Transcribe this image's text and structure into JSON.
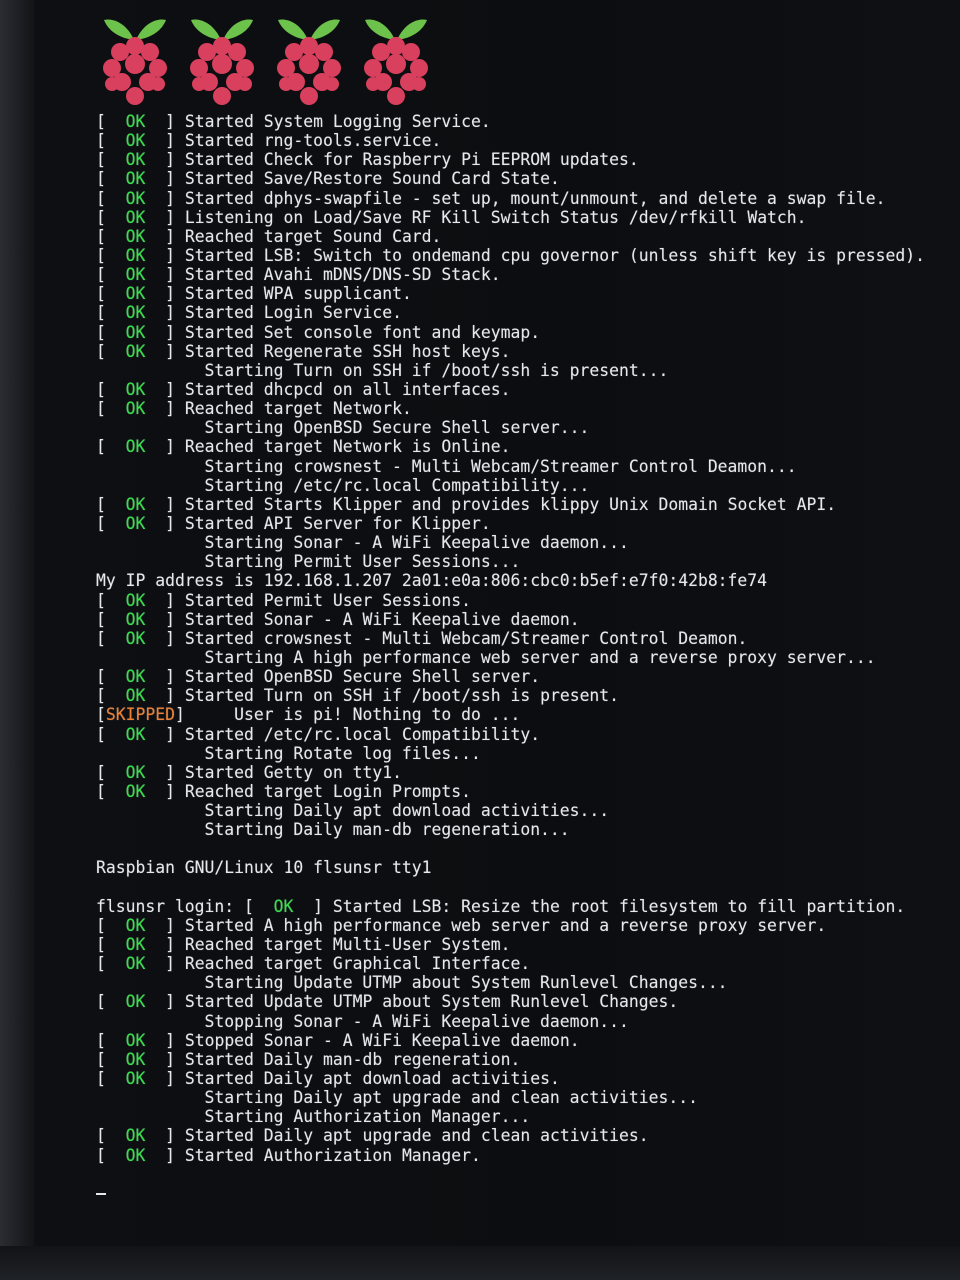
{
  "screen": {
    "logos": [
      "raspberry-logo",
      "raspberry-logo",
      "raspberry-logo",
      "raspberry-logo"
    ],
    "colors": {
      "ok": "#35e04a",
      "skipped": "#f08030",
      "text": "#e6e8ea",
      "background": "#0c0e12",
      "berry": "#d8405e",
      "leaf": "#6cc24a"
    }
  },
  "console": {
    "lines": [
      {
        "status": "OK",
        "text": "Started System Logging Service."
      },
      {
        "status": "OK",
        "text": "Started rng-tools.service."
      },
      {
        "status": "OK",
        "text": "Started Check for Raspberry Pi EEPROM updates."
      },
      {
        "status": "OK",
        "text": "Started Save/Restore Sound Card State."
      },
      {
        "status": "OK",
        "text": "Started dphys-swapfile - set up, mount/unmount, and delete a swap file."
      },
      {
        "status": "OK",
        "text": "Listening on Load/Save RF Kill Switch Status /dev/rfkill Watch."
      },
      {
        "status": "OK",
        "text": "Reached target Sound Card."
      },
      {
        "status": "OK",
        "text": "Started LSB: Switch to ondemand cpu governor (unless shift key is pressed)."
      },
      {
        "status": "OK",
        "text": "Started Avahi mDNS/DNS-SD Stack."
      },
      {
        "status": "OK",
        "text": "Started WPA supplicant."
      },
      {
        "status": "OK",
        "text": "Started Login Service."
      },
      {
        "status": "OK",
        "text": "Started Set console font and keymap."
      },
      {
        "status": "OK",
        "text": "Started Regenerate SSH host keys."
      },
      {
        "status": "",
        "text": "Starting Turn on SSH if /boot/ssh is present..."
      },
      {
        "status": "OK",
        "text": "Started dhcpcd on all interfaces."
      },
      {
        "status": "OK",
        "text": "Reached target Network."
      },
      {
        "status": "",
        "text": "Starting OpenBSD Secure Shell server..."
      },
      {
        "status": "OK",
        "text": "Reached target Network is Online."
      },
      {
        "status": "",
        "text": "Starting crowsnest - Multi Webcam/Streamer Control Deamon..."
      },
      {
        "status": "",
        "text": "Starting /etc/rc.local Compatibility..."
      },
      {
        "status": "OK",
        "text": "Started Starts Klipper and provides klippy Unix Domain Socket API."
      },
      {
        "status": "OK",
        "text": "Started API Server for Klipper."
      },
      {
        "status": "",
        "text": "Starting Sonar - A WiFi Keepalive daemon..."
      },
      {
        "status": "",
        "text": "Starting Permit User Sessions..."
      },
      {
        "status": "raw",
        "text": "My IP address is 192.168.1.207 2a01:e0a:806:cbc0:b5ef:e7f0:42b8:fe74"
      },
      {
        "status": "OK",
        "text": "Started Permit User Sessions."
      },
      {
        "status": "OK",
        "text": "Started Sonar - A WiFi Keepalive daemon."
      },
      {
        "status": "OK",
        "text": "Started crowsnest - Multi Webcam/Streamer Control Deamon."
      },
      {
        "status": "",
        "text": "Starting A high performance web server and a reverse proxy server..."
      },
      {
        "status": "OK",
        "text": "Started OpenBSD Secure Shell server."
      },
      {
        "status": "OK",
        "text": "Started Turn on SSH if /boot/ssh is present."
      },
      {
        "status": "SKIPPED",
        "text": "User is pi! Nothing to do ..."
      },
      {
        "status": "OK",
        "text": "Started /etc/rc.local Compatibility."
      },
      {
        "status": "",
        "text": "Starting Rotate log files..."
      },
      {
        "status": "OK",
        "text": "Started Getty on tty1."
      },
      {
        "status": "OK",
        "text": "Reached target Login Prompts."
      },
      {
        "status": "",
        "text": "Starting Daily apt download activities..."
      },
      {
        "status": "",
        "text": "Starting Daily man-db regeneration..."
      },
      {
        "status": "blank",
        "text": ""
      },
      {
        "status": "raw",
        "text": "Raspbian GNU/Linux 10 flsunsr tty1"
      },
      {
        "status": "blank",
        "text": ""
      },
      {
        "status": "login",
        "prompt": "flsunsr login: ",
        "text": "Started LSB: Resize the root filesystem to fill partition."
      },
      {
        "status": "OK",
        "text": "Started A high performance web server and a reverse proxy server."
      },
      {
        "status": "OK",
        "text": "Reached target Multi-User System."
      },
      {
        "status": "OK",
        "text": "Reached target Graphical Interface."
      },
      {
        "status": "",
        "text": "Starting Update UTMP about System Runlevel Changes..."
      },
      {
        "status": "OK",
        "text": "Started Update UTMP about System Runlevel Changes."
      },
      {
        "status": "",
        "text": "Stopping Sonar - A WiFi Keepalive daemon..."
      },
      {
        "status": "OK",
        "text": "Stopped Sonar - A WiFi Keepalive daemon."
      },
      {
        "status": "OK",
        "text": "Started Daily man-db regeneration."
      },
      {
        "status": "OK",
        "text": "Started Daily apt download activities."
      },
      {
        "status": "",
        "text": "Starting Daily apt upgrade and clean activities..."
      },
      {
        "status": "",
        "text": "Starting Authorization Manager..."
      },
      {
        "status": "OK",
        "text": "Started Daily apt upgrade and clean activities."
      },
      {
        "status": "OK",
        "text": "Started Authorization Manager."
      },
      {
        "status": "blank",
        "text": ""
      },
      {
        "status": "cursor",
        "text": ""
      }
    ]
  }
}
